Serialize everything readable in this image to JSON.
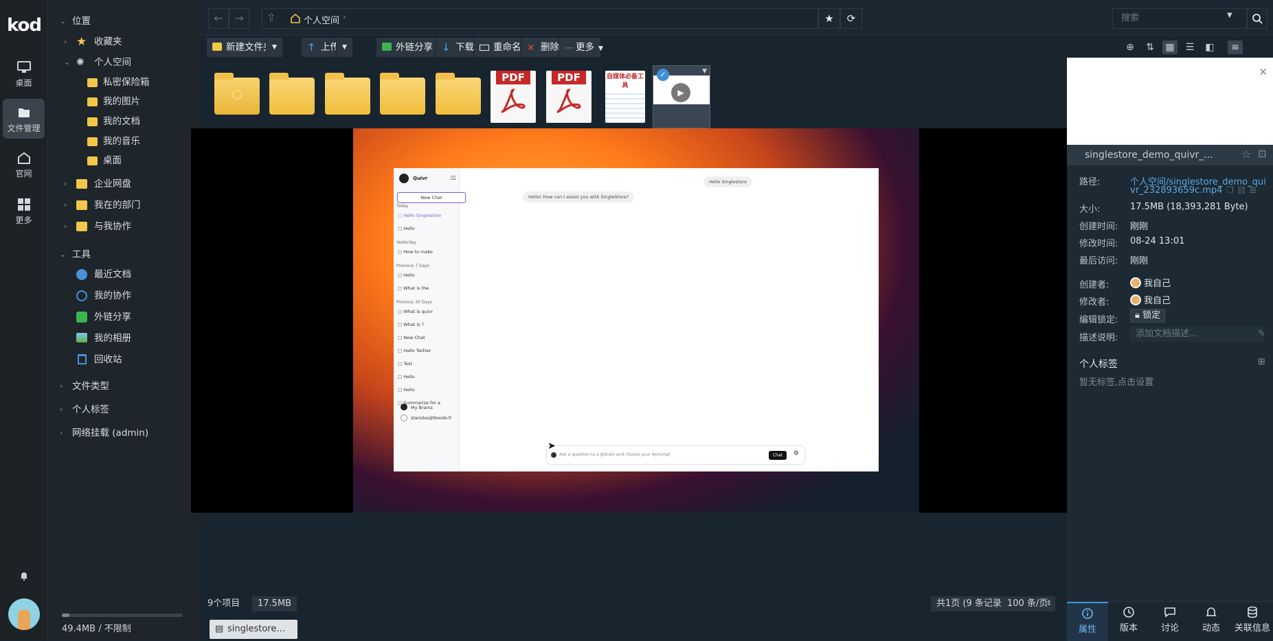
{
  "rail": {
    "logo": "kod",
    "items": [
      {
        "label": "桌面",
        "icon": "monitor-icon"
      },
      {
        "label": "文件管理",
        "icon": "files-icon"
      },
      {
        "label": "官网",
        "icon": "home-icon"
      },
      {
        "label": "更多",
        "icon": "grid-icon"
      }
    ]
  },
  "tree": {
    "location_header": "位置",
    "favorites": "收藏夹",
    "personal_space": "个人空间",
    "children": [
      "私密保险箱",
      "我的图片",
      "我的文档",
      "我的音乐",
      "桌面"
    ],
    "enterprise": "企业网盘",
    "my_dept": "我在的部门",
    "collab": "与我协作",
    "tools_header": "工具",
    "tools": [
      "最近文档",
      "我的协作",
      "外链分享",
      "我的相册",
      "回收站"
    ],
    "file_types": "文件类型",
    "personal_tags": "个人标签",
    "network_mount": "网络挂载 (admin)",
    "quota": "49.4MB / 不限制",
    "quota_used_fraction": 0.06
  },
  "topbar": {
    "path": "个人空间",
    "search_placeholder": "搜索"
  },
  "toolbar": {
    "new_folder": "新建文件夹",
    "upload": "上传",
    "share": "外链分享",
    "download": "下载",
    "rename": "重命名",
    "delete": "删除",
    "more": "更多"
  },
  "files": {
    "pdf_label": "PDF",
    "thumb_label": "自媒体必备工具"
  },
  "viewer": {
    "app_name": "Quivr",
    "new_chat": "New Chat",
    "sections": [
      {
        "header": "Today",
        "items": [
          "Hello Singlestore",
          "Hello"
        ]
      },
      {
        "header": "Yesterday",
        "items": [
          "How to make"
        ]
      },
      {
        "header": "Previous 7 Days",
        "items": [
          "Hello",
          "What is the"
        ]
      },
      {
        "header": "Previous 30 Days",
        "items": [
          "What is quivr",
          "What is ?",
          "New Chat",
          "Hello Twitter",
          "Test",
          "Hello",
          "Hello",
          "Summarize for a"
        ]
      }
    ],
    "my_brains": "My Brains",
    "user_email": "stanislas@theodo.fr",
    "user_msg": "Hello Singlestore",
    "bot_msg": "Hello! How can I assist you with SingleStore?",
    "composer_placeholder": "Ask a question to a @brain and choose your #prompt",
    "chat_btn": "Chat"
  },
  "status": {
    "items": "9个项目",
    "size": "17.5MB",
    "pages": "共1页 (9 条记录)",
    "per_page": "100 条/页",
    "taskbar_item": "singlestore…"
  },
  "panel": {
    "title": "singlestore_demo_quivr_...",
    "path_key": "路径:",
    "path_val_1": "个人空间/singlestore_demo_qui",
    "path_val_2": "vr_232893659c.mp4",
    "size_key": "大小:",
    "size_val": "17.5MB (18,393,281 Byte)",
    "created_key": "创建时间:",
    "created_val": "刚刚",
    "modified_key": "修改时间:",
    "modified_val": "08-24 13:01",
    "accessed_key": "最后访问:",
    "accessed_val": "刚刚",
    "creator_key": "创建者:",
    "creator_val": "我自己",
    "modifier_key": "修改者:",
    "modifier_val": "我自己",
    "lock_key": "编辑锁定:",
    "lock_val": "锁定",
    "desc_key": "描述说明:",
    "desc_placeholder": "添加文档描述...",
    "tags_header": "个人标签",
    "tags_empty": "暂无标签,点击设置",
    "tabs": [
      "属性",
      "版本",
      "讨论",
      "动态",
      "关联信息"
    ]
  },
  "colors": {
    "accent": "#3d8fd6",
    "folder": "#f3c64a",
    "link": "#5aa8e6"
  }
}
